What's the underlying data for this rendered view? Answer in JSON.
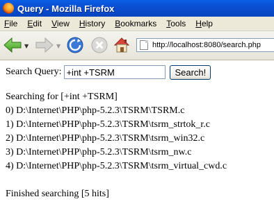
{
  "window": {
    "title": "Query - Mozilla Firefox"
  },
  "menu": [
    {
      "label": "File",
      "key": "F",
      "rest": "ile"
    },
    {
      "label": "Edit",
      "key": "E",
      "rest": "dit"
    },
    {
      "label": "View",
      "key": "V",
      "rest": "iew"
    },
    {
      "label": "History",
      "key": "H",
      "rest": "istory"
    },
    {
      "label": "Bookmarks",
      "key": "B",
      "rest": "ookmarks"
    },
    {
      "label": "Tools",
      "key": "T",
      "rest": "ools"
    },
    {
      "label": "Help",
      "key": "H",
      "rest": "elp"
    }
  ],
  "toolbar": {
    "url": "http://localhost:8080/search.php",
    "icons": [
      "back-arrow-icon",
      "forward-arrow-icon",
      "reload-icon",
      "stop-icon",
      "home-icon"
    ]
  },
  "search": {
    "label": "Search Query:",
    "value": "+int +TSRM",
    "button": "Search!"
  },
  "results": {
    "header": "Searching for [+int +TSRM]",
    "items": [
      "0) D:\\Internet\\PHP\\php-5.2.3\\TSRM\\TSRM.c",
      "1) D:\\Internet\\PHP\\php-5.2.3\\TSRM\\tsrm_strtok_r.c",
      "2) D:\\Internet\\PHP\\php-5.2.3\\TSRM\\tsrm_win32.c",
      "3) D:\\Internet\\PHP\\php-5.2.3\\TSRM\\tsrm_nw.c",
      "4) D:\\Internet\\PHP\\php-5.2.3\\TSRM\\tsrm_virtual_cwd.c"
    ],
    "footer": "Finished searching [5 hits]"
  }
}
